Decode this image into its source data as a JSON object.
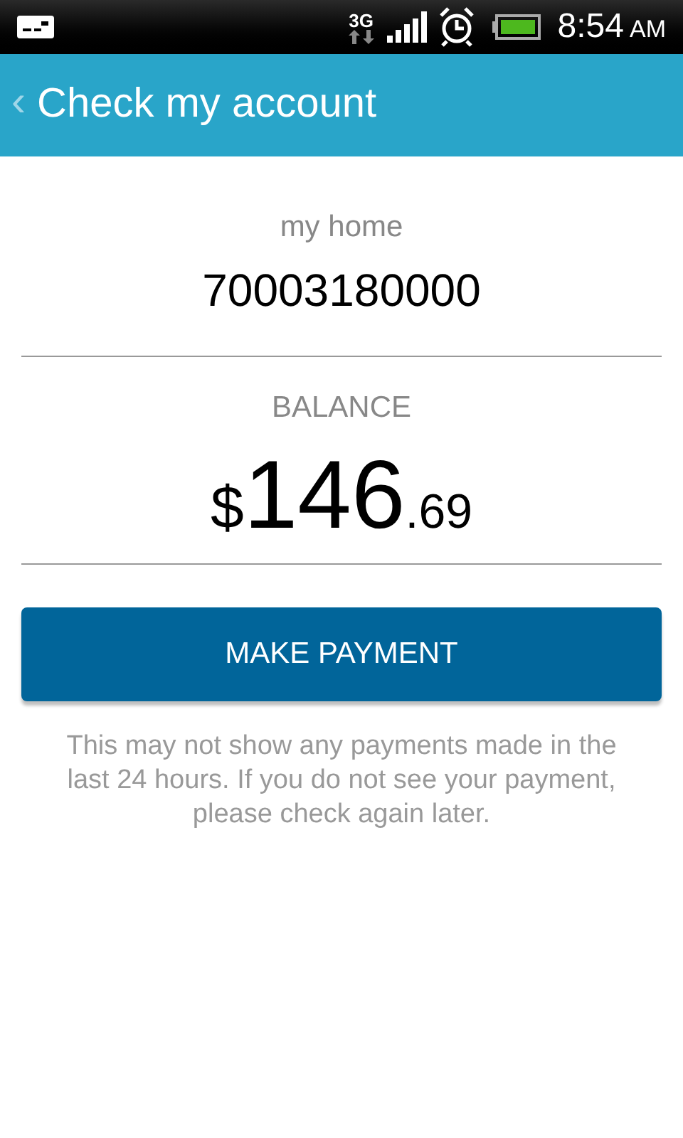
{
  "status_bar": {
    "network": "3G",
    "time": "8:54",
    "meridiem": "AM"
  },
  "header": {
    "back": "‹",
    "title": "Check my account"
  },
  "account": {
    "name": "my home",
    "number": "70003180000"
  },
  "balance": {
    "label": "BALANCE",
    "currency": "$",
    "whole": "146",
    "cents": ".69"
  },
  "button": {
    "label": "MAKE PAYMENT"
  },
  "note": "This may not show any payments made in the last 24 hours. If you do not see your payment, please check again later."
}
